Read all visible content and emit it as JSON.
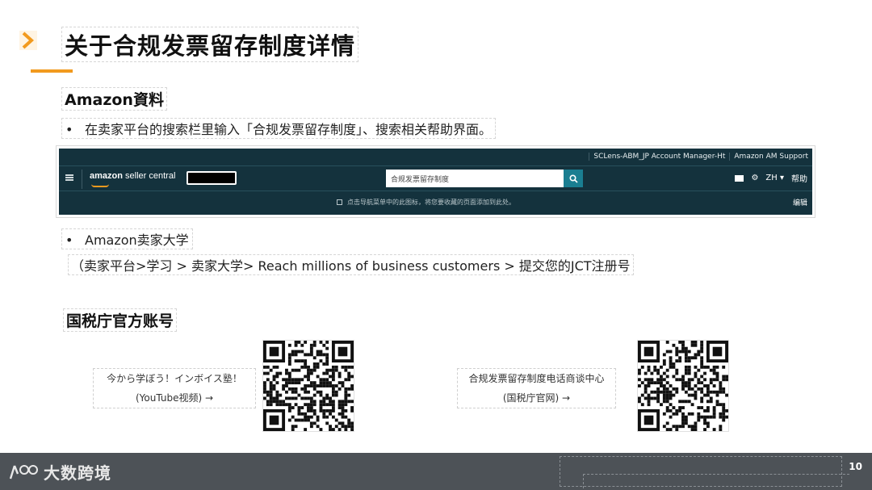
{
  "title": "关于合规发票留存制度详情",
  "section_amazon": {
    "heading": "Amazon資料",
    "bullet1_marker": "•",
    "bullet1": "在卖家平台的搜索栏里输入「合规发票留存制度」、搜索相关帮助界面。",
    "bullet2_marker": "•",
    "bullet2": "Amazon卖家大学",
    "path": "（卖家平台>学习 > 卖家大学> Reach millions of business customers > 提交您的JCT注册号"
  },
  "seller_central": {
    "top_links": [
      "SCLens-ABM_JP Account Manager-Ht",
      "Amazon AM Support"
    ],
    "logo_bold": "amazon",
    "logo_rest": " seller central",
    "search_value": "合规发票留存制度",
    "lang": "ZH ▾",
    "help": "帮助",
    "bottom_text": "点击导航菜单中的此图标，将您要收藏的页面添加到此处。",
    "edit": "编辑",
    "colors": {
      "bar": "#14323d",
      "search_button": "#1a7e91"
    }
  },
  "section_nta": {
    "heading": "国税庁官方账号",
    "qr1_line1": "今から学ぼう！インボイス塾！",
    "qr1_line2": "(YouTube视频) →",
    "qr2_line1": "合规发票留存制度电话商谈中心",
    "qr2_line2": "(国税庁官网) →"
  },
  "footer": {
    "brand": "大数跨境",
    "page_number": "10"
  },
  "colors": {
    "accent": "#f29a1e",
    "footer": "#4d5257"
  }
}
